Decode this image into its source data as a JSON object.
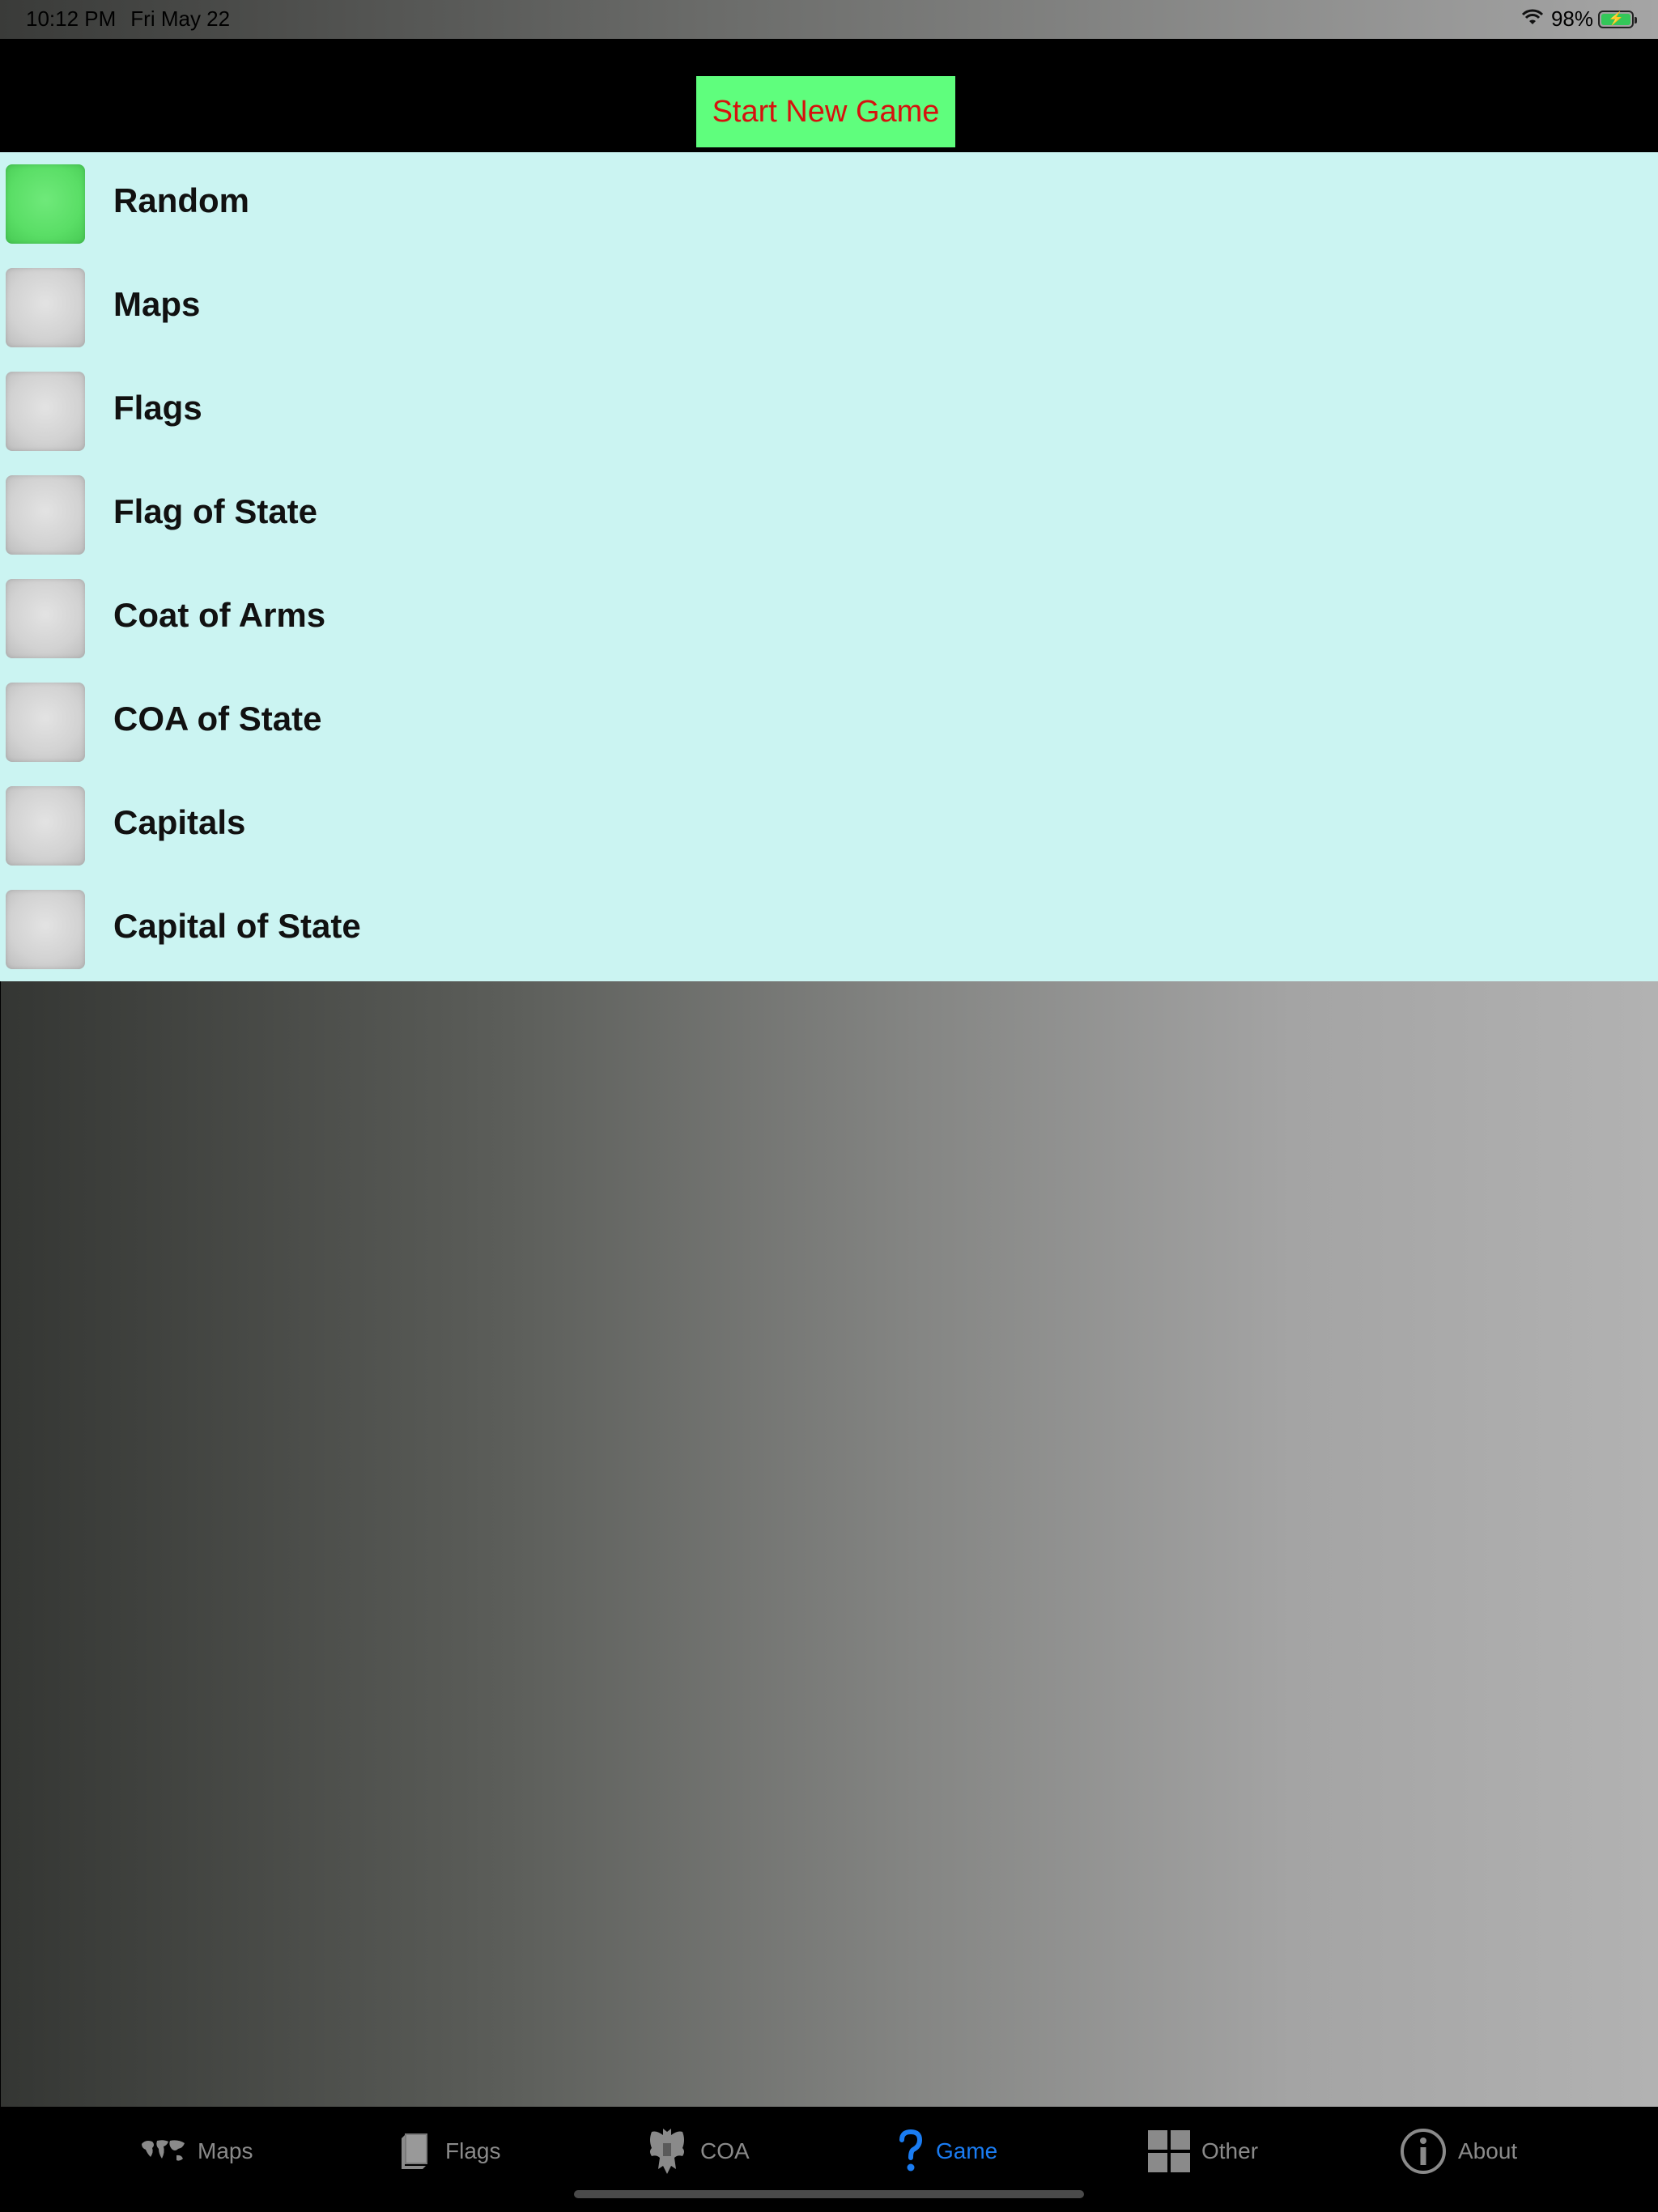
{
  "status_bar": {
    "time": "10:12 PM",
    "date": "Fri May 22",
    "battery_percent": "98%",
    "battery_charging_glyph": "⚡",
    "wifi_icon": "wifi-icon",
    "battery_icon": "battery-charging-icon"
  },
  "header": {
    "start_button_label": "Start New Game",
    "start_button_bg": "#5ffe7d",
    "start_button_text_color": "#d6120e"
  },
  "game_modes": {
    "items": [
      {
        "label": "Random",
        "selected": true
      },
      {
        "label": "Maps",
        "selected": false
      },
      {
        "label": "Flags",
        "selected": false
      },
      {
        "label": "Flag of State",
        "selected": false
      },
      {
        "label": "Coat of Arms",
        "selected": false
      },
      {
        "label": "COA of State",
        "selected": false
      },
      {
        "label": "Capitals",
        "selected": false
      },
      {
        "label": "Capital of State",
        "selected": false
      }
    ],
    "background": "#cbf4f2",
    "selected_color": "#5ade66"
  },
  "tab_bar": {
    "tabs": [
      {
        "label": "Maps",
        "icon": "world-map-icon",
        "active": false
      },
      {
        "label": "Flags",
        "icon": "flag-book-icon",
        "active": false
      },
      {
        "label": "COA",
        "icon": "eagle-icon",
        "active": false
      },
      {
        "label": "Game",
        "icon": "question-mark-icon",
        "active": true
      },
      {
        "label": "Other",
        "icon": "grid-icon",
        "active": false
      },
      {
        "label": "About",
        "icon": "info-icon",
        "active": false
      }
    ],
    "active_color": "#1a7cf2",
    "inactive_color": "#8a8a8a"
  }
}
